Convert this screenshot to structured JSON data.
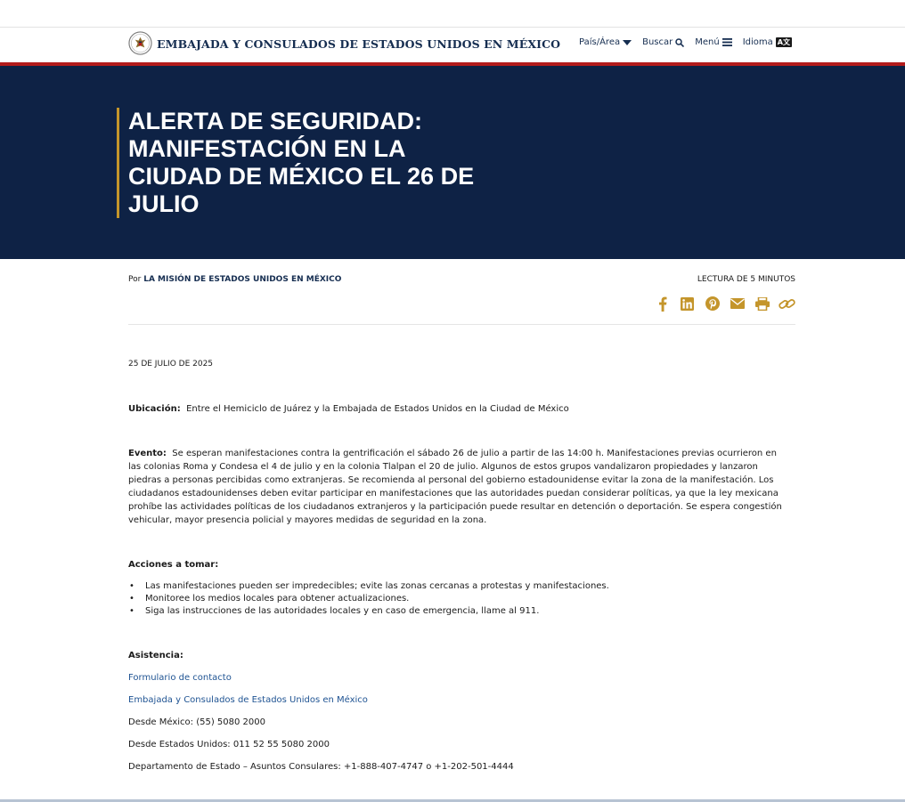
{
  "header": {
    "site_name": "EMBAJADA Y CONSULADOS DE ESTADOS UNIDOS EN MÉXICO",
    "nav": {
      "country": "País/Área",
      "search": "Buscar",
      "menu": "Menú",
      "language": "Idioma",
      "language_badge": "A文"
    }
  },
  "hero": {
    "title": "ALERTA DE SEGURIDAD: MANIFESTACIÓN EN LA CIUDAD DE MÉXICO EL 26 DE JULIO"
  },
  "meta": {
    "by_prefix": "Por",
    "author": "LA MISIÓN DE ESTADOS UNIDOS EN MÉXICO",
    "read_time": "LECTURA DE 5 MINUTOS",
    "share_icons": [
      "facebook-icon",
      "linkedin-icon",
      "pinterest-icon",
      "email-icon",
      "print-icon",
      "link-icon"
    ]
  },
  "article": {
    "date": "25 DE JULIO DE 2025",
    "ubicacion_label": "Ubicación:",
    "ubicacion_text": "Entre el Hemiciclo de Juárez y la Embajada de Estados Unidos en la Ciudad de México",
    "evento_label": "Evento:",
    "evento_text": "Se esperan manifestaciones contra la gentrificación el sábado 26 de julio a partir de las 14:00 h. Manifestaciones previas ocurrieron en las colonias Roma y Condesa el 4 de julio y en la colonia Tlalpan el 20 de julio. Algunos de estos grupos vandalizaron propiedades y lanzaron piedras a personas percibidas como extranjeras. Se recomienda al personal del gobierno estadounidense evitar la zona de la manifestación. Los ciudadanos estadounidenses deben evitar participar en manifestaciones que las autoridades puedan considerar políticas, ya que la ley mexicana prohíbe las actividades políticas de los ciudadanos extranjeros y la participación puede resultar en detención o deportación. Se espera congestión vehicular, mayor presencia policial y mayores medidas de seguridad en la zona.",
    "acciones_label": "Acciones a tomar:",
    "acciones": [
      "Las manifestaciones pueden ser impredecibles; evite las zonas cercanas a protestas y manifestaciones.",
      "Monitoree los medios locales para obtener actualizaciones.",
      "Siga las instrucciones de las autoridades locales y en caso de emergencia, llame al 911."
    ],
    "asistencia_label": "Asistencia:",
    "links": [
      "Formulario de contacto",
      "Embajada y Consulados de Estados Unidos en México"
    ],
    "contacts": [
      "Desde México: (55) 5080 2000",
      "Desde Estados Unidos: 011 52 55 5080 2000",
      "Departamento de Estado – Asuntos Consulares: +1-888-407-4747 o +1-202-501-4444"
    ]
  },
  "colors": {
    "navy": "#0e2245",
    "red": "#b31b1b",
    "gold": "#c4952b",
    "link": "#205493"
  }
}
